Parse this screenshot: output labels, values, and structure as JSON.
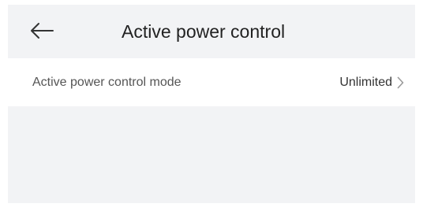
{
  "header": {
    "title": "Active power control",
    "back_icon": "arrow-left-icon"
  },
  "settings": {
    "items": [
      {
        "label": "Active power control mode",
        "value": "Unlimited",
        "icon": "chevron-right-icon"
      }
    ]
  },
  "colors": {
    "header_bg": "#f2f3f5",
    "row_bg": "#ffffff",
    "title_text": "#222222",
    "label_text": "#555555",
    "value_text": "#333333",
    "chevron": "#9a9a9a"
  }
}
